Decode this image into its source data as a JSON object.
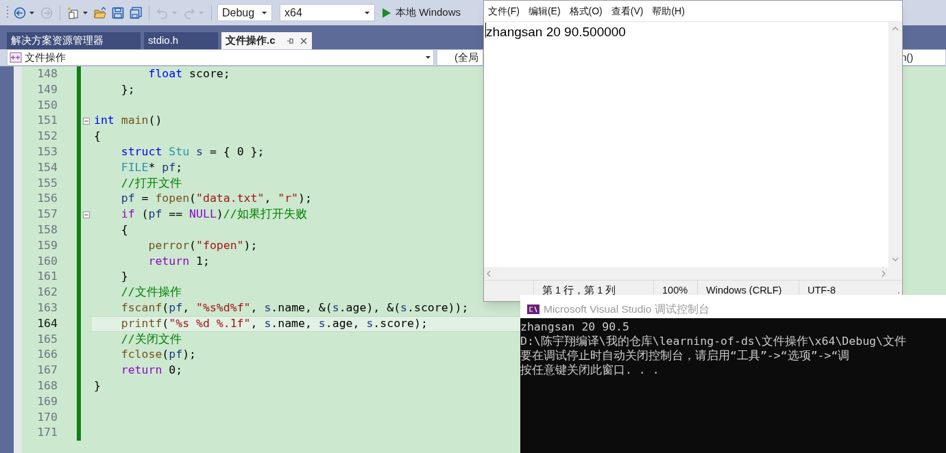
{
  "toolbar": {
    "buttons": [
      {
        "kind": "back",
        "disabled": false,
        "dropdown": true
      },
      {
        "kind": "forward",
        "disabled": true,
        "dropdown": false
      },
      {
        "kind": "new_project",
        "disabled": false,
        "dropdown": true
      },
      {
        "kind": "open",
        "disabled": false,
        "dropdown": false
      },
      {
        "kind": "save",
        "disabled": false,
        "dropdown": false
      },
      {
        "kind": "save_all",
        "disabled": false,
        "dropdown": false
      },
      {
        "kind": "undo",
        "disabled": true,
        "dropdown": true
      },
      {
        "kind": "redo",
        "disabled": true,
        "dropdown": true
      }
    ],
    "configuration": "Debug",
    "platform": "x64",
    "run_label": "本地 Windows"
  },
  "tabs": [
    {
      "label": "解决方案资源管理器",
      "selected": false
    },
    {
      "label": "stdio.h",
      "selected": false
    },
    {
      "label": "文件操作.c",
      "selected": true
    }
  ],
  "navigation": {
    "scope": "文件操作",
    "context": "(全局",
    "member": "n()"
  },
  "editor": {
    "lines": [
      {
        "number": "148",
        "current": false,
        "tokens": [
          {
            "kind": "keyword",
            "text": "        float"
          },
          {
            "kind": "plain",
            "text": " score;"
          }
        ]
      },
      {
        "number": "149",
        "current": false,
        "tokens": [
          {
            "kind": "plain",
            "text": "    };"
          }
        ]
      },
      {
        "number": "150",
        "current": false
      },
      {
        "number": "151",
        "current": false,
        "fold": true,
        "tokens": [
          {
            "kind": "keyword",
            "text": "int"
          },
          {
            "kind": "function",
            "text": " main"
          },
          {
            "kind": "plain",
            "text": "()"
          }
        ]
      },
      {
        "number": "152",
        "current": false,
        "tokens": [
          {
            "kind": "plain",
            "text": "{"
          }
        ]
      },
      {
        "number": "153",
        "current": false,
        "tokens": [
          {
            "kind": "keyword",
            "text": "    struct"
          },
          {
            "kind": "type",
            "text": " Stu"
          },
          {
            "kind": "variable",
            "text": " s"
          },
          {
            "kind": "plain",
            "text": " = { 0 };"
          }
        ]
      },
      {
        "number": "154",
        "current": false,
        "tokens": [
          {
            "kind": "type",
            "text": "    FILE"
          },
          {
            "kind": "plain",
            "text": "* "
          },
          {
            "kind": "variable",
            "text": "pf"
          },
          {
            "kind": "plain",
            "text": ";"
          }
        ]
      },
      {
        "number": "155",
        "current": false,
        "tokens": [
          {
            "kind": "comment",
            "text": "    //打开文件"
          }
        ]
      },
      {
        "number": "156",
        "current": false,
        "tokens": [
          {
            "kind": "variable",
            "text": "    pf"
          },
          {
            "kind": "plain",
            "text": " = "
          },
          {
            "kind": "function",
            "text": "fopen"
          },
          {
            "kind": "plain",
            "text": "("
          },
          {
            "kind": "string",
            "text": "\"data.txt\""
          },
          {
            "kind": "plain",
            "text": ", "
          },
          {
            "kind": "string",
            "text": "\"r\""
          },
          {
            "kind": "plain",
            "text": ");"
          }
        ]
      },
      {
        "number": "157",
        "current": false,
        "fold": true,
        "tokens": [
          {
            "kind": "control",
            "text": "    if"
          },
          {
            "kind": "plain",
            "text": " ("
          },
          {
            "kind": "variable",
            "text": "pf"
          },
          {
            "kind": "plain",
            "text": " == "
          },
          {
            "kind": "macro",
            "text": "NULL"
          },
          {
            "kind": "plain",
            "text": ")"
          },
          {
            "kind": "comment",
            "text": "//如果打开失败"
          }
        ]
      },
      {
        "number": "158",
        "current": false,
        "tokens": [
          {
            "kind": "plain",
            "text": "    {"
          }
        ]
      },
      {
        "number": "159",
        "current": false,
        "tokens": [
          {
            "kind": "function",
            "text": "        perror"
          },
          {
            "kind": "plain",
            "text": "("
          },
          {
            "kind": "string",
            "text": "\"fopen\""
          },
          {
            "kind": "plain",
            "text": ");"
          }
        ]
      },
      {
        "number": "160",
        "current": false,
        "tokens": [
          {
            "kind": "control",
            "text": "        return"
          },
          {
            "kind": "plain",
            "text": " 1;"
          }
        ]
      },
      {
        "number": "161",
        "current": false,
        "tokens": [
          {
            "kind": "plain",
            "text": "    }"
          }
        ]
      },
      {
        "number": "162",
        "current": false,
        "tokens": [
          {
            "kind": "comment",
            "text": "    //文件操作"
          }
        ]
      },
      {
        "number": "163",
        "current": false,
        "tokens": [
          {
            "kind": "function",
            "text": "    fscanf"
          },
          {
            "kind": "plain",
            "text": "("
          },
          {
            "kind": "variable",
            "text": "pf"
          },
          {
            "kind": "plain",
            "text": ", "
          },
          {
            "kind": "string",
            "text": "\"%s%d%f\""
          },
          {
            "kind": "plain",
            "text": ", "
          },
          {
            "kind": "variable",
            "text": "s"
          },
          {
            "kind": "plain",
            "text": ".name, &("
          },
          {
            "kind": "variable",
            "text": "s"
          },
          {
            "kind": "plain",
            "text": ".age), &("
          },
          {
            "kind": "variable",
            "text": "s"
          },
          {
            "kind": "plain",
            "text": ".score));"
          }
        ]
      },
      {
        "number": "164",
        "current": true,
        "tokens": [
          {
            "kind": "function",
            "text": "    printf"
          },
          {
            "kind": "plain",
            "text": "("
          },
          {
            "kind": "string",
            "text": "\"%s %d %.1f\""
          },
          {
            "kind": "plain",
            "text": ", "
          },
          {
            "kind": "variable",
            "text": "s"
          },
          {
            "kind": "plain",
            "text": ".name, "
          },
          {
            "kind": "variable",
            "text": "s"
          },
          {
            "kind": "plain",
            "text": ".age, "
          },
          {
            "kind": "variable",
            "text": "s"
          },
          {
            "kind": "plain",
            "text": ".score);"
          }
        ]
      },
      {
        "number": "165",
        "current": false,
        "tokens": [
          {
            "kind": "comment",
            "text": "    //关闭文件"
          }
        ]
      },
      {
        "number": "166",
        "current": false,
        "tokens": [
          {
            "kind": "function",
            "text": "    fclose"
          },
          {
            "kind": "plain",
            "text": "("
          },
          {
            "kind": "variable",
            "text": "pf"
          },
          {
            "kind": "plain",
            "text": ");"
          }
        ]
      },
      {
        "number": "167",
        "current": false,
        "tokens": [
          {
            "kind": "control",
            "text": "    return"
          },
          {
            "kind": "plain",
            "text": " 0;"
          }
        ]
      },
      {
        "number": "168",
        "current": false,
        "tokens": [
          {
            "kind": "plain",
            "text": "}"
          }
        ]
      },
      {
        "number": "169",
        "current": false
      },
      {
        "number": "170",
        "current": false
      },
      {
        "number": "171",
        "current": false
      }
    ]
  },
  "notepad": {
    "menu": [
      "文件(F)",
      "编辑(E)",
      "格式(O)",
      "查看(V)",
      "帮助(H)"
    ],
    "content": "zhangsan 20 90.500000",
    "status": [
      "第 1 行，第 1 列",
      "100%",
      "Windows (CRLF)",
      "UTF-8"
    ]
  },
  "console": {
    "title": "Microsoft Visual Studio 调试控制台",
    "lines": [
      "zhangsan 20 90.5",
      "D:\\陈宇翔编译\\我的仓库\\learning-of-ds\\文件操作\\x64\\Debug\\文件",
      "要在调试停止时自动关闭控制台，请启用“工具”->“选项”->“调",
      "按任意键关闭此窗口. . ."
    ]
  }
}
